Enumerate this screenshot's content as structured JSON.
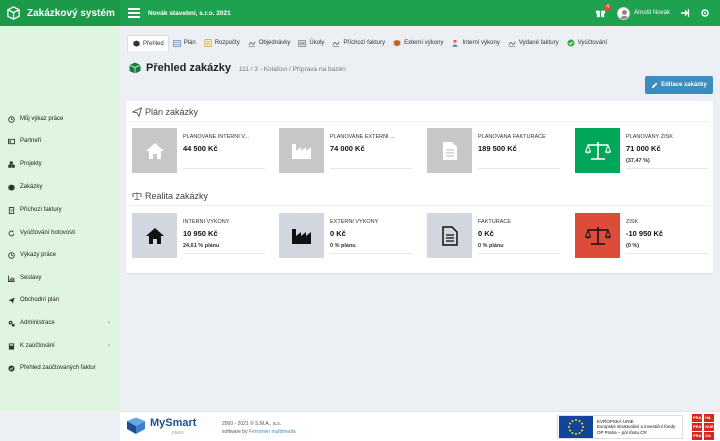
{
  "brand": {
    "title": "Zakázkový systém",
    "company": "Novák stavební, s.r.o. 2021"
  },
  "user": {
    "name": "Arnošt Novák",
    "notifications": "4"
  },
  "sidebar": {
    "items": [
      {
        "label": "Můj výkaz práce",
        "icon": "clock-icon"
      },
      {
        "label": "Partneři",
        "icon": "card-icon"
      },
      {
        "label": "Projekty",
        "icon": "cubes-icon"
      },
      {
        "label": "Zakázky",
        "icon": "cube-icon"
      },
      {
        "label": "Příchozí faktury",
        "icon": "doc-icon"
      },
      {
        "label": "Vyúčtování hotovosti",
        "icon": "refresh-icon"
      },
      {
        "label": "Výkazy práce",
        "icon": "clock-icon"
      },
      {
        "label": "Sestavy",
        "icon": "bar-chart-icon"
      },
      {
        "label": "Obchodní plán",
        "icon": "send-icon"
      },
      {
        "label": "Administrace",
        "icon": "gears-icon",
        "caret": "‹"
      },
      {
        "label": "K zaúčtování",
        "icon": "calc-icon",
        "caret": "‹"
      },
      {
        "label": "Přehled zaúčtovaných faktur",
        "icon": "check-circle-icon"
      }
    ]
  },
  "tabs": [
    {
      "label": "Přehled",
      "active": true
    },
    {
      "label": "Plán"
    },
    {
      "label": "Rozpočty"
    },
    {
      "label": "Objednávky"
    },
    {
      "label": "Úkoly"
    },
    {
      "label": "Příchozí faktury"
    },
    {
      "label": "Externí výkony"
    },
    {
      "label": "Interní výkony"
    },
    {
      "label": "Vydané faktury"
    },
    {
      "label": "Vyúčtování"
    }
  ],
  "page": {
    "title": "Přehled zakázky",
    "breadcrumb": "111 / 3 - Kolářovi / Příprava na bazén",
    "edit_label": "Editace zakázky"
  },
  "plan": {
    "title": "Plán zakázky",
    "boxes": [
      {
        "label": "PLÁNOVANÉ INTERNÍ V...",
        "value": "44 500 Kč",
        "sub": "",
        "icon": "home-icon"
      },
      {
        "label": "PLÁNOVANÉ EXTERNÍ ...",
        "value": "74 000 Kč",
        "sub": "",
        "icon": "industry-icon"
      },
      {
        "label": "PLÁNOVANÁ FAKTURACE",
        "value": "189 500 Kč",
        "sub": "",
        "icon": "file-text-icon"
      },
      {
        "label": "PLÁNOVANÝ ZISK",
        "value": "71 000 Kč",
        "sub": "(37,47 %)",
        "icon": "balance-scale-icon"
      }
    ]
  },
  "reality": {
    "title": "Realita zakázky",
    "boxes": [
      {
        "label": "INTERNÍ VÝKONY",
        "value": "10 950 Kč",
        "sub": "24,61 % plánu",
        "icon": "home-icon"
      },
      {
        "label": "EXTERNÍ VÝKONY",
        "value": "0 Kč",
        "sub": "0 % plánu",
        "icon": "industry-icon"
      },
      {
        "label": "FAKTURACE",
        "value": "0 Kč",
        "sub": "0 % plánu",
        "icon": "file-text-icon"
      },
      {
        "label": "ZISK",
        "value": "-10 950 Kč",
        "sub": "(0 %)",
        "icon": "balance-scale-icon"
      }
    ]
  },
  "footer": {
    "logo_main": "MySmart",
    "logo_sub": "place",
    "copyright": "2000 - 2021 © S.M.A., a.s.",
    "software_by": "software by",
    "software_link": "Fenomen multimedia",
    "eu_line1": "EVROPSKÁ UNIE",
    "eu_line2": "Evropské strukturální a investiční fondy",
    "eu_line3": "OP Praha – pól růstu ČR",
    "praha": [
      "PRA",
      "HA",
      "PRA",
      "GUE",
      "PRA",
      "GA"
    ]
  },
  "colors": {
    "topbar": "#1fa24f",
    "sidebar": "#dff5df",
    "box_gray": "#c7c7c7",
    "profit_green": "#00a65a",
    "loss_red": "#dd4b39",
    "reality_light": "#d2d6de",
    "button_blue": "#3c8dbc"
  }
}
